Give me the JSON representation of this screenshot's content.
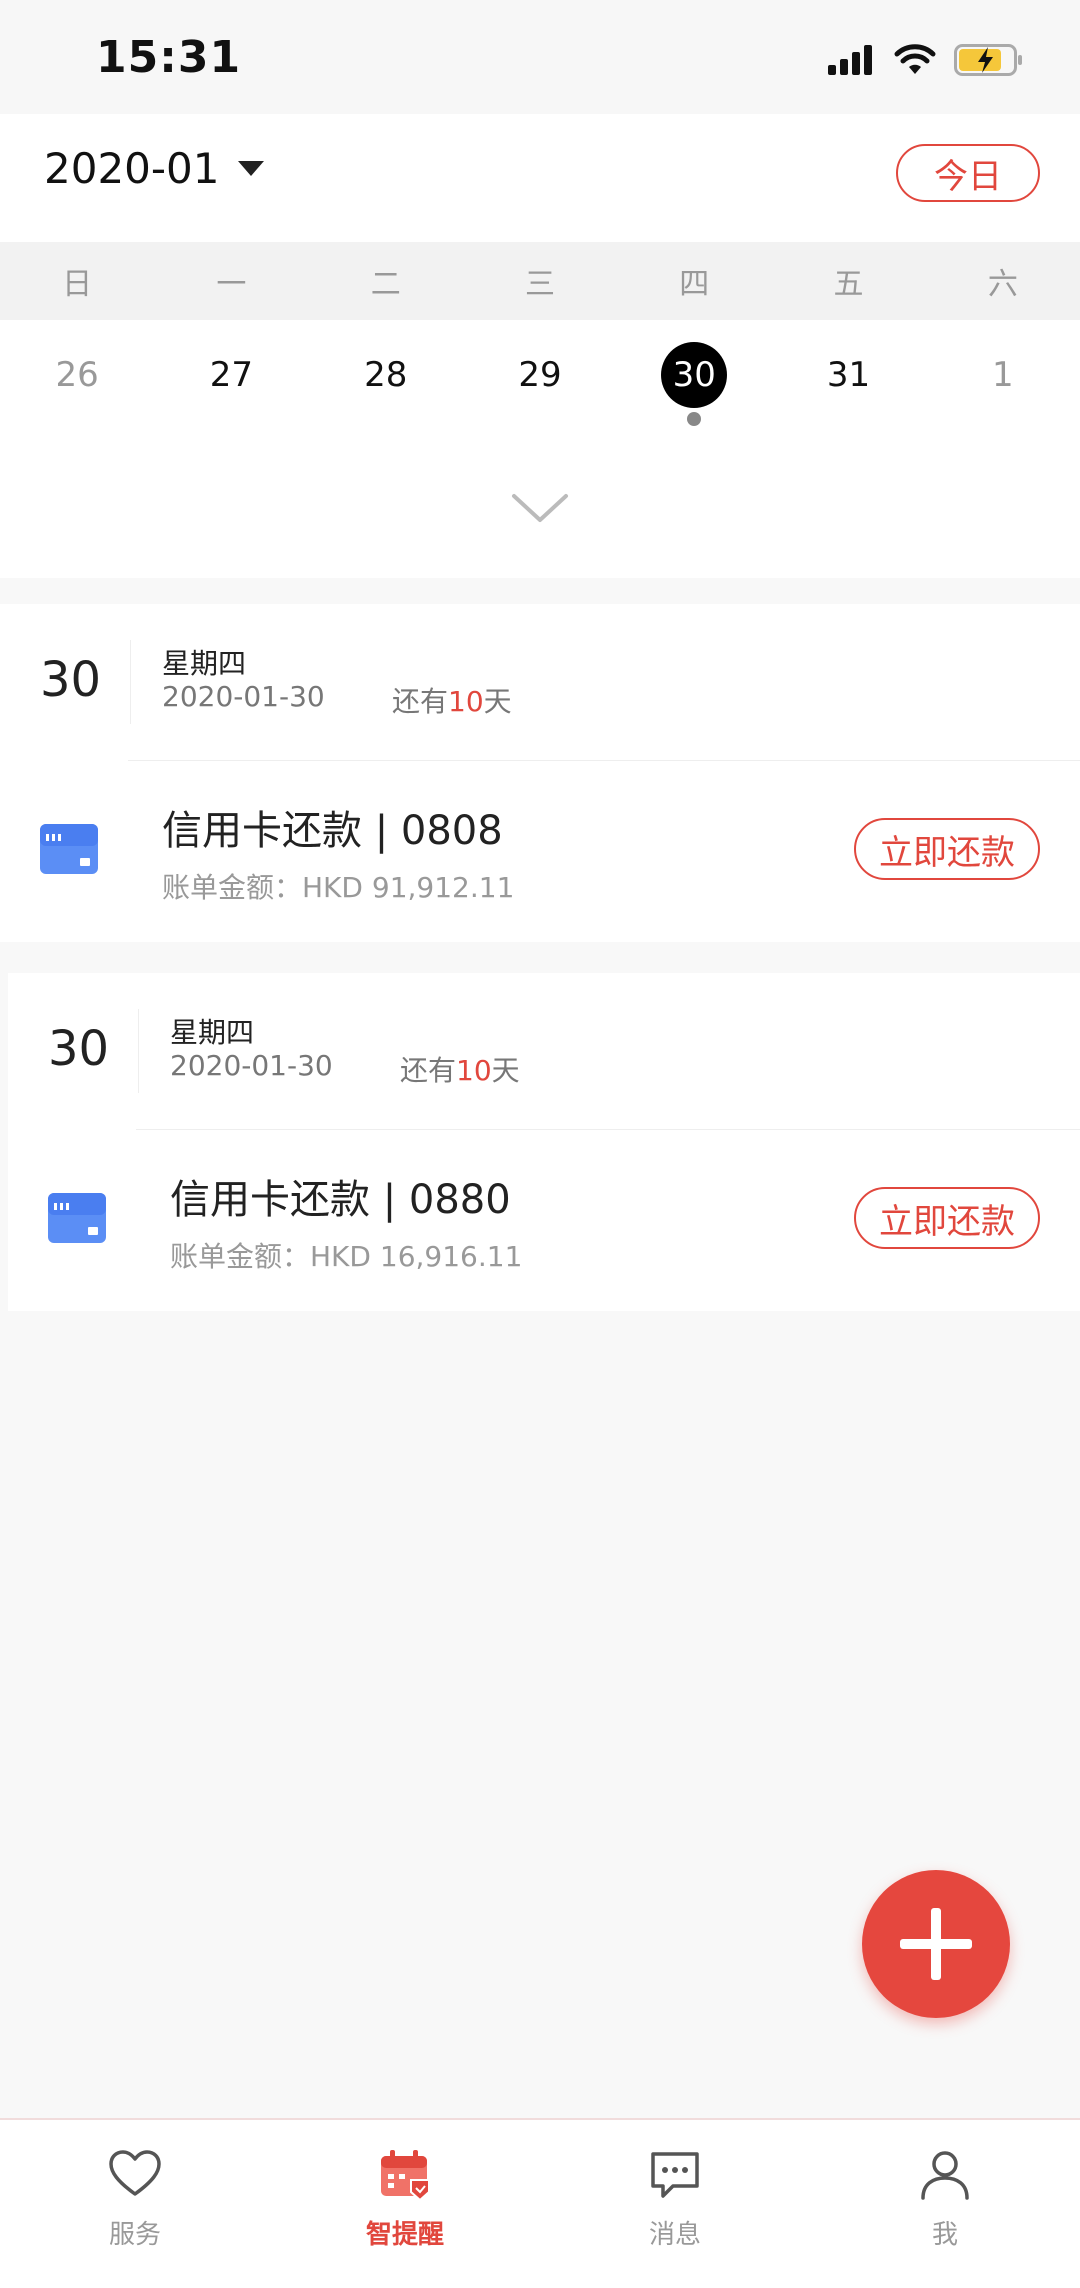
{
  "status_bar": {
    "time": "15:31"
  },
  "header": {
    "month": "2020-01",
    "today_label": "今日"
  },
  "week_days": [
    "日",
    "一",
    "二",
    "三",
    "四",
    "五",
    "六"
  ],
  "calendar_days": [
    {
      "label": "26",
      "muted": true
    },
    {
      "label": "27",
      "muted": false
    },
    {
      "label": "28",
      "muted": false
    },
    {
      "label": "29",
      "muted": false
    },
    {
      "label": "30",
      "selected": true,
      "has_event": true
    },
    {
      "label": "31",
      "muted": false
    },
    {
      "label": "1",
      "muted": true
    }
  ],
  "reminders": [
    {
      "day": "30",
      "weekday": "星期四",
      "date": "2020-01-30",
      "remain_prefix": "还有",
      "remain_days": "10",
      "remain_suffix": "天",
      "title": "信用卡还款 | 0808",
      "amount": "账单金额：HKD 91,912.11",
      "action": "立即还款"
    },
    {
      "day": "30",
      "weekday": "星期四",
      "date": "2020-01-30",
      "remain_prefix": "还有",
      "remain_days": "10",
      "remain_suffix": "天",
      "title": "信用卡还款 | 0880",
      "amount": "账单金额：HKD 16,916.11",
      "action": "立即还款"
    }
  ],
  "tabs": [
    {
      "label": "服务",
      "icon": "heart-icon"
    },
    {
      "label": "智提醒",
      "icon": "calendar-icon",
      "active": true
    },
    {
      "label": "消息",
      "icon": "chat-icon"
    },
    {
      "label": "我",
      "icon": "user-icon"
    }
  ],
  "colors": {
    "accent": "#e1473d",
    "card_icon": "#5b8ef5"
  }
}
